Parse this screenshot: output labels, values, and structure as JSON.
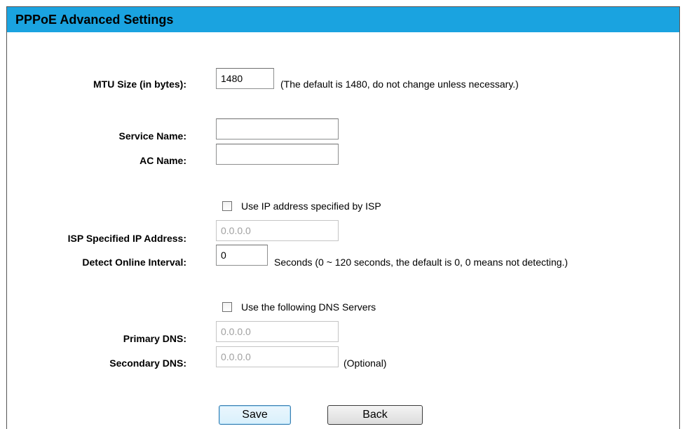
{
  "header": {
    "title": "PPPoE Advanced Settings"
  },
  "mtu": {
    "label": "MTU Size (in bytes):",
    "value": "1480",
    "note": "(The default is 1480, do not change unless necessary.)"
  },
  "service_name": {
    "label": "Service Name:",
    "value": ""
  },
  "ac_name": {
    "label": "AC Name:",
    "value": ""
  },
  "use_isp_ip": {
    "label": "Use IP address specified by ISP",
    "checked": false
  },
  "isp_ip": {
    "label": "ISP Specified IP Address:",
    "value": "0.0.0.0",
    "disabled": true
  },
  "detect_interval": {
    "label": "Detect Online Interval:",
    "value": "0",
    "note": "Seconds (0 ~ 120 seconds, the default is 0, 0 means not detecting.)"
  },
  "use_dns": {
    "label": "Use the following DNS Servers",
    "checked": false
  },
  "primary_dns": {
    "label": "Primary DNS:",
    "value": "0.0.0.0",
    "disabled": true
  },
  "secondary_dns": {
    "label": "Secondary DNS:",
    "value": "0.0.0.0",
    "disabled": true,
    "note": "(Optional)"
  },
  "buttons": {
    "save": "Save",
    "back": "Back"
  },
  "colors": {
    "title_bar": "#1aa3e0",
    "disabled_text": "#a0a0a0"
  }
}
